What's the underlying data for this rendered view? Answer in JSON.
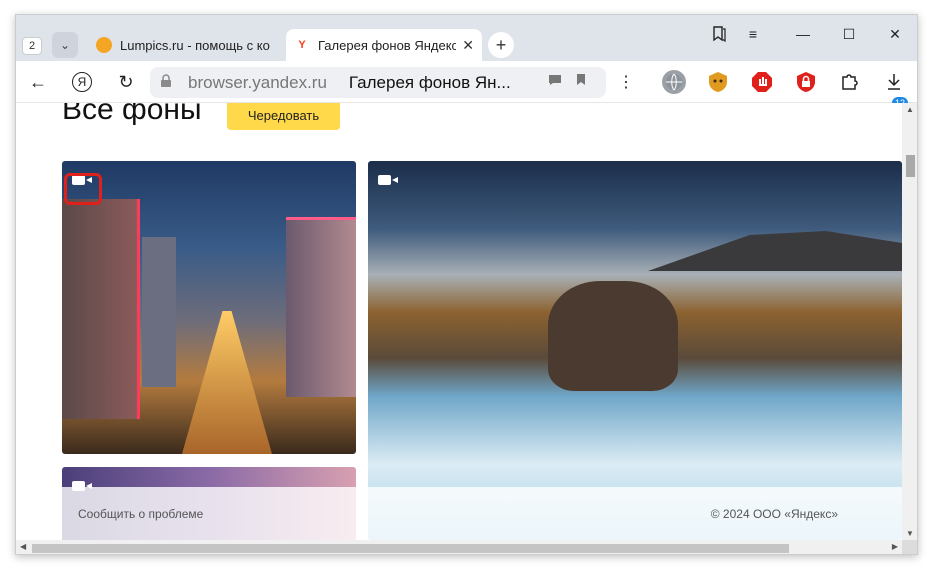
{
  "tabstrip": {
    "tab_count": "2",
    "tabs": [
      {
        "title": "Lumpics.ru - помощь с ком",
        "favicon": "lumpics-orange-icon"
      },
      {
        "title": "Галерея фонов Яндекс",
        "favicon": "yandex-y-icon"
      }
    ],
    "new_tab_label": "+",
    "window_controls": [
      "bookmark-collection-icon",
      "minimize-icon",
      "maximize-icon",
      "close-icon"
    ]
  },
  "toolbar": {
    "back_icon": "←",
    "yandex_icon": "Я",
    "reload_icon": "↻",
    "omnibox": {
      "domain": "browser.yandex.ru",
      "page_title": "Галерея фонов Ян..."
    },
    "extensions_badge": "12"
  },
  "content": {
    "heading": "Все фоны",
    "shuffle_button": "Чередовать",
    "footer": {
      "report_link": "Сообщить о проблеме",
      "copyright": "© 2024 ООО «Яндекс»"
    }
  },
  "colors": {
    "accent_yellow": "#ffd94a",
    "highlight_red": "#e0201a",
    "yandex_red": "#fc3f1d"
  }
}
